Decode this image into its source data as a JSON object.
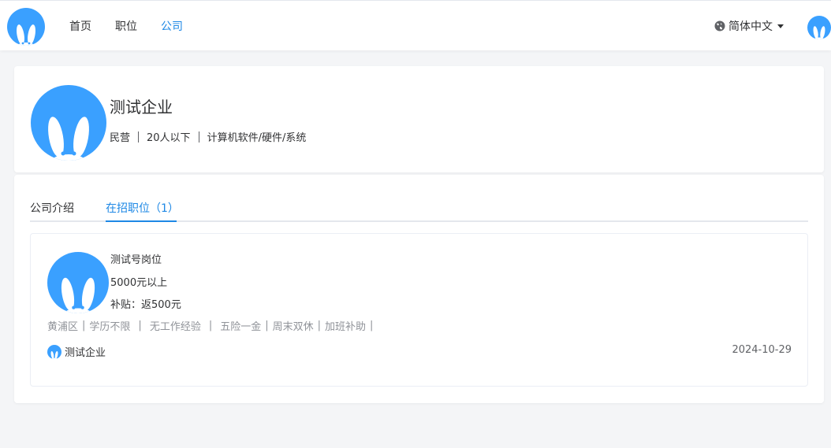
{
  "nav": {
    "items": [
      {
        "label": "首页",
        "active": false
      },
      {
        "label": "职位",
        "active": false
      },
      {
        "label": "公司",
        "active": true
      }
    ],
    "language": "简体中文",
    "icons": {
      "logo": "rabbit-logo-icon",
      "globe": "globe-icon",
      "caret": "caret-down-icon",
      "avatar": "rabbit-avatar-icon"
    }
  },
  "company": {
    "name": "测试企业",
    "ownership": "民营",
    "size": "20人以下",
    "industry": "计算机软件/硬件/系统"
  },
  "tabs": [
    {
      "label": "公司介绍",
      "active": false
    },
    {
      "label": "在招职位（1）",
      "active": true
    }
  ],
  "jobs": [
    {
      "title": "测试号岗位",
      "salary": "5000元以上",
      "subsidy": "补贴：返500元",
      "tags": {
        "district": "黄浦区",
        "education": "学历不限",
        "experience": "无工作经验",
        "benefits": [
          "五险一金",
          "周末双休",
          "加班补助"
        ]
      },
      "company": "测试企业",
      "date": "2024-10-29"
    }
  ],
  "colors": {
    "accent": "#1e88e5",
    "logo_blue": "#3aa0ff",
    "bg": "#f4f5f7"
  }
}
